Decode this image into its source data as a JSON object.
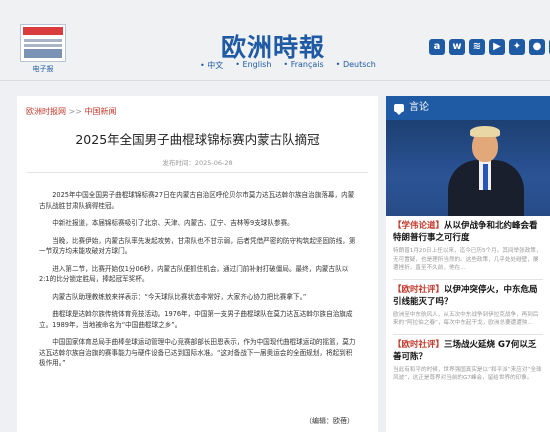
{
  "header": {
    "epaper_label": "电子报",
    "logo": "欧洲時報",
    "languages": [
      "中文",
      "English",
      "Français",
      "Deutsch"
    ],
    "social_icons": [
      "app-icon",
      "weibo-icon",
      "rss-icon",
      "video-icon",
      "share-icon",
      "wechat-icon",
      "mini-program-icon"
    ]
  },
  "breadcrumb": {
    "home": "欧洲时报网",
    "separator": ">>",
    "section": "中国新闻"
  },
  "article": {
    "title": "2025年全国男子曲棍球锦标赛内蒙古队摘冠",
    "date": "发布时间：2025-06-28",
    "paragraphs": [
      "2025年中国全国男子曲棍球锦标赛27日在内蒙古自治区呼伦贝尔市莫力达瓦达斡尔族自治旗落幕，内蒙古队战胜甘肃队摘得桂冠。",
      "中新社报道，本届锦标赛吸引了北京、天津、内蒙古、辽宁、吉林等9支球队参赛。",
      "当晚，比赛伊始，内蒙古队率先发起攻势，甘肃队也不甘示弱，后者凭借严密的防守构筑起坚固防线，第一节双方均未能攻破对方球门。",
      "进入第二节，比赛开始仅1分06秒，内蒙古队便抓住机会，通过门前补射打破僵局。最终，内蒙古队以2:1的比分锁定胜局，捧起冠军奖杯。",
      "内蒙古队助理教练敖来祥表示：“今天球队比赛状态非常好，大家齐心协力把比赛拿下。”",
      "曲棍球是达斡尔族传统体育竞技活动。1976年，中国第一支男子曲棍球队在莫力达瓦达斡尔族自治旗成立。1989年，当地被命名为“中国曲棍球之乡”。",
      "中国国家体育总局手曲棒垒球运动管理中心竞赛部部长田恩表示，作为中国现代曲棍球运动的摇篮，莫力达瓦达斡尔族自治旗的赛事能力与硬件设备已达到国际水准。“这对备战下一届奥运会的全面规划，将起到积极作用。”"
    ],
    "editor": "（编辑：欧蓓）"
  },
  "sidebar": {
    "header": "言论",
    "items": [
      {
        "tag": "【学伟论道】",
        "title": "从以伊战争和北约峰会看特朗普行事之可行度",
        "desc": "特朗普1月20日上任以来，迄今已历5个月。其间举张政策，无可置疑，也是理所当然的。这些政策，几乎处处碰壁，屡遭挫折，直至不久前，他在..."
      },
      {
        "tag": "【欧时社评】",
        "title": "以伊冲突停火，中东危局引线能灭了吗？",
        "desc": "欧洲至中东航风人，从五次中东战争到伊拉克战争，再到后来的“阿拉伯之春”，每次中东起干戈，欧洲总要遭遭殃..."
      },
      {
        "tag": "【欧时社评】",
        "title": "三场战火延烧 G7何以乏善可陈？",
        "desc": "当此有和平的时候，世界强国真实是以“和平派”来应对“全球风波”，这正是尊界对当前的G7峰会，留给世界的印象。"
      }
    ]
  }
}
